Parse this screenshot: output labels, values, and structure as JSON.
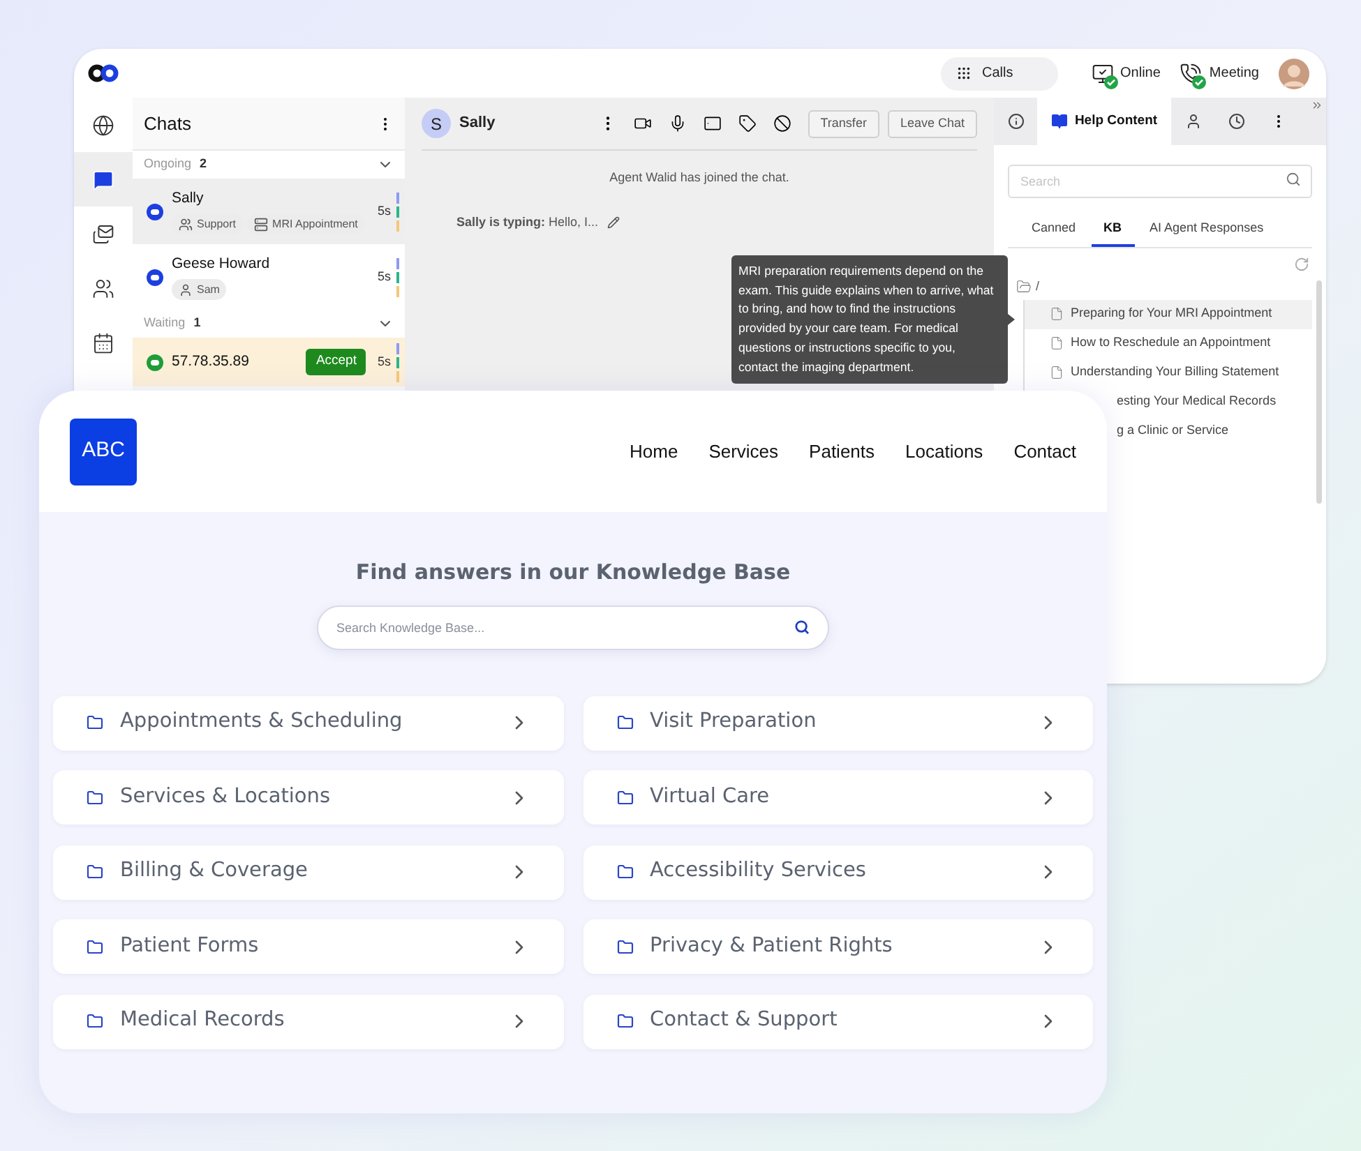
{
  "agent_app": {
    "top_bar": {
      "calls": "Calls",
      "statuses": [
        {
          "kind": "screen",
          "label": "Online"
        },
        {
          "kind": "phone",
          "label": "Meeting"
        }
      ]
    },
    "rail": [
      {
        "selected": false
      },
      {
        "selected": true
      },
      {
        "selected": false
      },
      {
        "selected": false
      },
      {
        "selected": false
      }
    ],
    "chats": {
      "title": "Chats",
      "groups": [
        {
          "label": "Ongoing",
          "count": "2",
          "items": [
            {
              "kind": "chat",
              "name": "Sally",
              "time": "5s",
              "selected": true,
              "tags": [
                {
                  "kind": "group",
                  "label": "Support"
                },
                {
                  "kind": "topic",
                  "label": "MRI Appointment"
                }
              ]
            },
            {
              "kind": "chat",
              "name": "Geese Howard",
              "time": "5s",
              "selected": false,
              "tags": [
                {
                  "kind": "person",
                  "label": "Sam"
                }
              ]
            }
          ]
        },
        {
          "label": "Waiting",
          "count": "1",
          "items": [
            {
              "kind": "waiting",
              "name": "57.78.35.89",
              "time": "5s",
              "selected": false,
              "action": "Accept"
            }
          ]
        }
      ]
    },
    "conversation": {
      "avatar": "S",
      "name": "Sally",
      "buttons": [
        "Transfer",
        "Leave Chat"
      ],
      "system_message": "Agent Walid has joined the chat.",
      "typing_label": "Sally is typing:",
      "typing_text": "Hello, I..."
    },
    "tooltip": "MRI preparation requirements depend on the exam. This guide explains when to arrive, what to bring, and how to find the instructions provided by your care team. For medical questions or instructions specific to you, contact the imaging department.",
    "side_panel": {
      "tabs": [
        {
          "kind": "info",
          "selected": false
        },
        {
          "kind": "help",
          "label": "Help Content",
          "selected": true
        },
        {
          "kind": "person",
          "selected": false
        },
        {
          "kind": "history",
          "selected": false
        }
      ],
      "search": {
        "placeholder": "Search"
      },
      "subtabs": [
        {
          "label": "Canned",
          "selected": false
        },
        {
          "label": "KB",
          "selected": true
        },
        {
          "label": "AI Agent Responses",
          "selected": false
        }
      ],
      "tree": {
        "label": "/",
        "children": [
          {
            "kind": "doc",
            "title": "Preparing for Your MRI Appointment",
            "selected": true
          },
          {
            "kind": "doc",
            "title": "How to Reschedule an Appointment",
            "selected": false
          },
          {
            "kind": "doc",
            "title": "Understanding Your Billing Statement",
            "selected": false
          },
          {
            "kind": "cut",
            "title": "esting Your Medical Records",
            "selected": false
          },
          {
            "kind": "cut",
            "title": "g a Clinic or Service",
            "selected": false
          }
        ]
      }
    }
  },
  "kb_site": {
    "logo": "ABC",
    "nav": [
      "Home",
      "Services",
      "Patients",
      "Locations",
      "Contact"
    ],
    "title": "Find answers in our Knowledge Base",
    "search": {
      "placeholder": "Search Knowledge Base..."
    },
    "categories": [
      "Appointments & Scheduling",
      "Visit Preparation",
      "Services & Locations",
      "Virtual Care",
      "Billing & Coverage",
      "Accessibility Services",
      "Patient Forms",
      "Privacy & Patient Rights",
      "Medical Records",
      "Contact & Support"
    ]
  }
}
